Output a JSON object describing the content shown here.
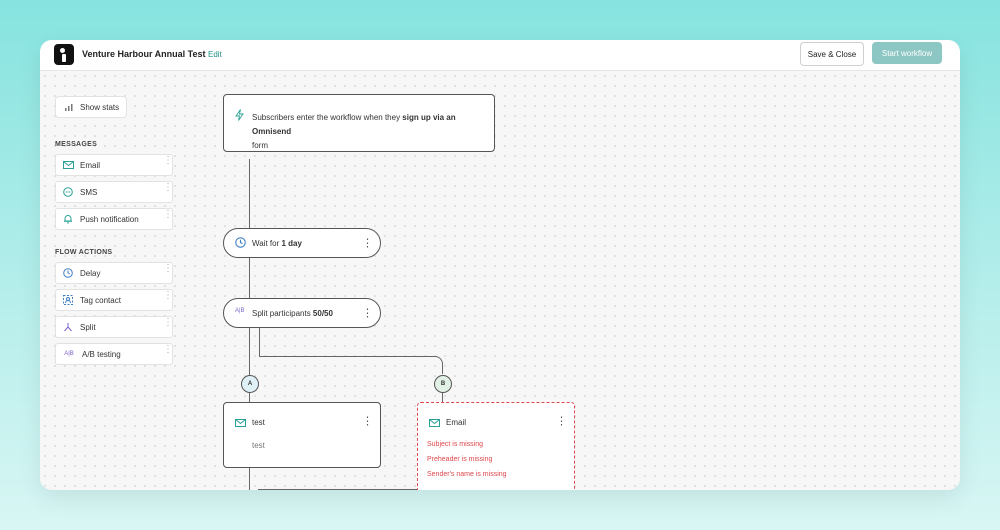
{
  "header": {
    "workflow_title": "Venture Harbour Annual Test",
    "edit_label": "Edit",
    "save_close_label": "Save & Close",
    "start_workflow_label": "Start workflow"
  },
  "sidebar": {
    "show_stats_label": "Show stats",
    "messages_heading": "MESSAGES",
    "messages": [
      {
        "label": "Email",
        "icon": "envelope-icon"
      },
      {
        "label": "SMS",
        "icon": "sms-icon"
      },
      {
        "label": "Push notification",
        "icon": "bell-icon"
      }
    ],
    "flow_actions_heading": "FLOW ACTIONS",
    "flow_actions": [
      {
        "label": "Delay",
        "icon": "clock-icon"
      },
      {
        "label": "Tag contact",
        "icon": "tag-icon"
      },
      {
        "label": "Split",
        "icon": "split-icon"
      },
      {
        "label": "A/B testing",
        "icon": "ab-icon"
      }
    ]
  },
  "flow": {
    "trigger": {
      "prefix": "Subscribers enter the workflow when they ",
      "bold": "sign up via an Omnisend",
      "suffix": "form"
    },
    "wait": {
      "prefix": "Wait for ",
      "bold": "1 day"
    },
    "split": {
      "prefix": "Split participants ",
      "bold": "50/50"
    },
    "branch_a": "A",
    "branch_b": "B",
    "node_a": {
      "title": "test",
      "subtitle": "test"
    },
    "node_b": {
      "title": "Email",
      "errors": [
        "Subject is missing",
        "Preheader is missing",
        "Sender's name is missing"
      ]
    }
  },
  "colors": {
    "accent": "#2aa196",
    "error": "#e0474c",
    "start_button": "#8dc7c4"
  }
}
